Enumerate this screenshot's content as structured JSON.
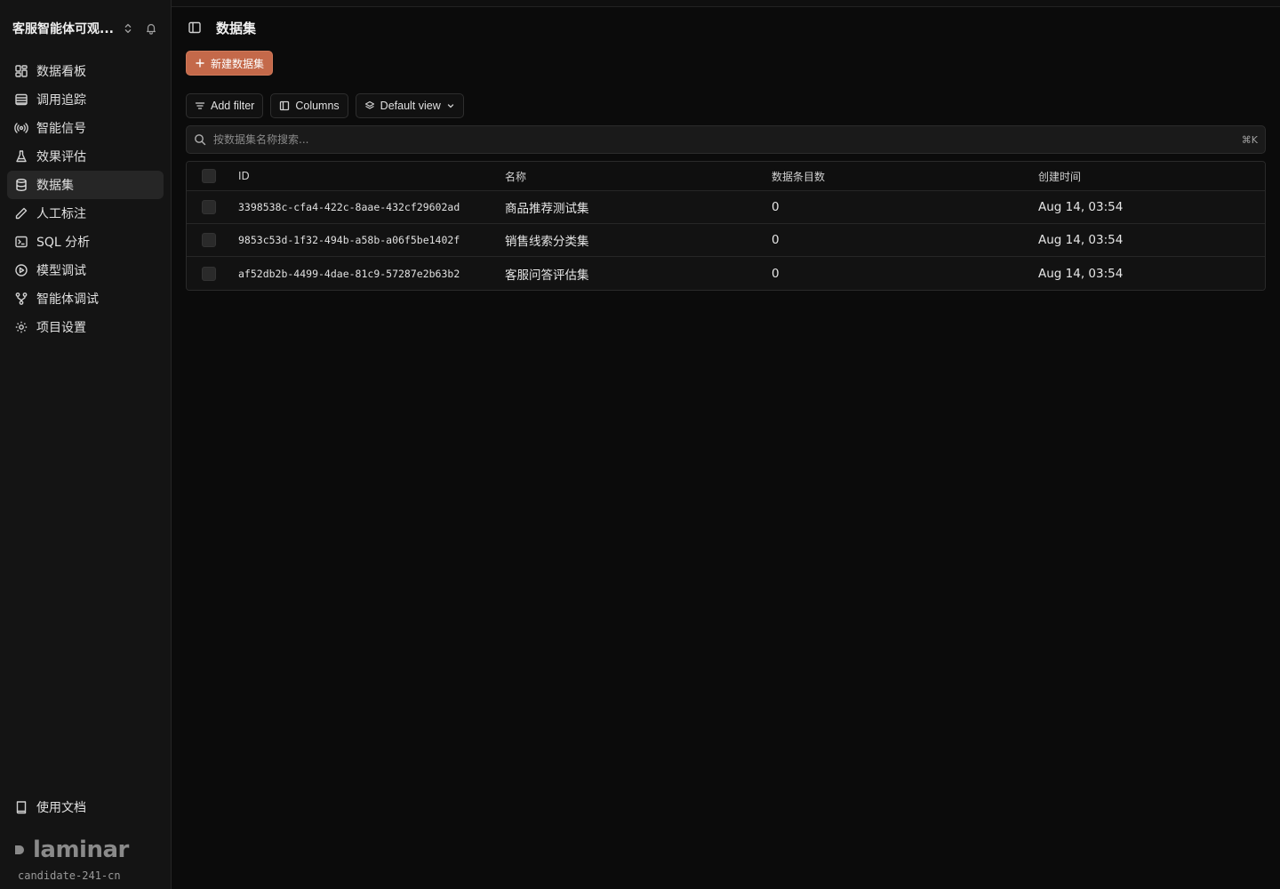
{
  "sidebar": {
    "project_name": "客服智能体可观...",
    "items": [
      {
        "label": "数据看板",
        "icon": "dashboard-icon"
      },
      {
        "label": "调用追踪",
        "icon": "list-icon"
      },
      {
        "label": "智能信号",
        "icon": "signal-icon"
      },
      {
        "label": "效果评估",
        "icon": "flask-icon"
      },
      {
        "label": "数据集",
        "icon": "database-icon"
      },
      {
        "label": "人工标注",
        "icon": "pencil-icon"
      },
      {
        "label": "SQL 分析",
        "icon": "terminal-icon"
      },
      {
        "label": "模型调试",
        "icon": "play-icon"
      },
      {
        "label": "智能体调试",
        "icon": "graph-icon"
      },
      {
        "label": "项目设置",
        "icon": "gear-icon"
      }
    ],
    "active_item": "数据集",
    "docs_label": "使用文档",
    "brand": "laminar",
    "workspace": "candidate-241-cn"
  },
  "header": {
    "title": "数据集"
  },
  "actions": {
    "new_dataset": "新建数据集"
  },
  "toolbar": {
    "add_filter": "Add filter",
    "columns": "Columns",
    "default_view": "Default view"
  },
  "search": {
    "placeholder": "按数据集名称搜索...",
    "shortcut": "⌘K"
  },
  "table": {
    "columns": [
      "ID",
      "名称",
      "数据条目数",
      "创建时间"
    ],
    "rows": [
      {
        "id": "3398538c-cfa4-422c-8aae-432cf29602ad",
        "name": "商品推荐测试集",
        "count": "0",
        "created": "Aug 14, 03:54"
      },
      {
        "id": "9853c53d-1f32-494b-a58b-a06f5be1402f",
        "name": "销售线索分类集",
        "count": "0",
        "created": "Aug 14, 03:54"
      },
      {
        "id": "af52db2b-4499-4dae-81c9-57287e2b63b2",
        "name": "客服问答评估集",
        "count": "0",
        "created": "Aug 14, 03:54"
      }
    ]
  },
  "colors": {
    "accent": "#c4694a",
    "background": "#0b0b0b",
    "sidebar": "#141414"
  }
}
